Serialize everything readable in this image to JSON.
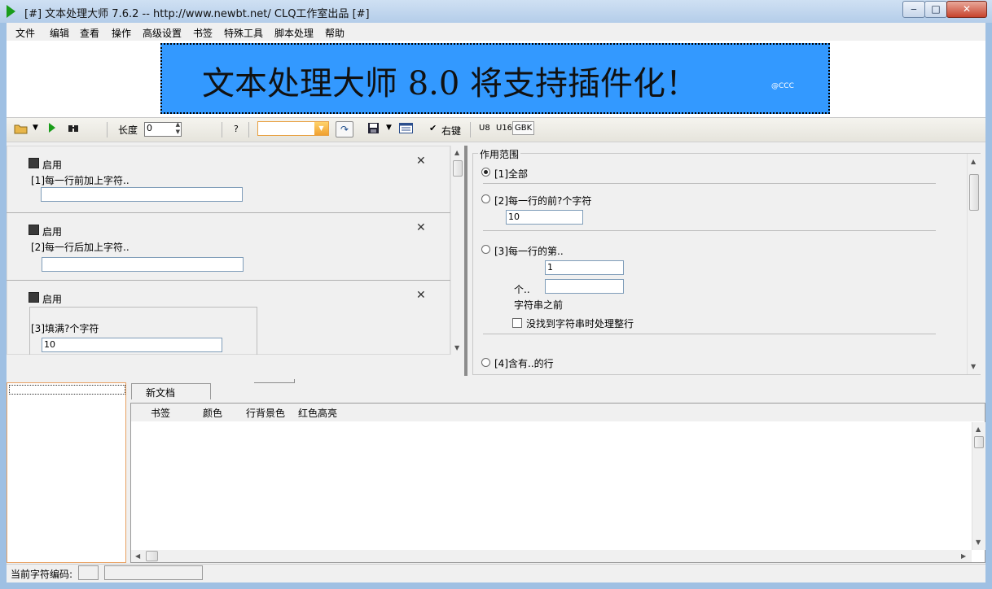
{
  "window": {
    "title": "[#] 文本处理大师 7.6.2 -- http://www.newbt.net/  CLQ工作室出品 [#]",
    "minimize": "‒",
    "maximize": "□",
    "close": "✕"
  },
  "menu": [
    "文件",
    "编辑",
    "查看",
    "操作",
    "高级设置",
    "书签",
    "特殊工具",
    "脚本处理",
    "帮助"
  ],
  "banner": {
    "text": "文本处理大师 8.0 将支持插件化！",
    "tag": "@CCC"
  },
  "toolbar": {
    "length_label": "长度",
    "length_value": "0",
    "help": "?",
    "right_key": "右键",
    "check_mark": "✔",
    "encodings": [
      "U8",
      "U16",
      "GBK"
    ]
  },
  "left_panel": {
    "blocks": [
      {
        "enable": "启用",
        "label": "[1]每一行前加上字符..",
        "value": ""
      },
      {
        "enable": "启用",
        "label": "[2]每一行后加上字符..",
        "value": ""
      },
      {
        "enable": "启用",
        "label": "[3]填满?个字符",
        "value": "10"
      }
    ],
    "close_glyph": "✕"
  },
  "scope": {
    "title": "作用范围",
    "opt1": "[1]全部",
    "opt2": "[2]每一行的前?个字符",
    "opt2_value": "10",
    "opt3": "[3]每一行的第..",
    "opt3_value": "1",
    "opt3_ge": "个..",
    "opt3_ge_value": "",
    "opt3_before": "字符串之前",
    "opt3_checkbox": "没找到字符串时处理整行",
    "opt4": "[4]含有..的行"
  },
  "bottom": {
    "tab_label": "新文档",
    "columns": [
      "书签",
      "颜色",
      "行背景色",
      "红色高亮"
    ]
  },
  "status": {
    "encoding_label": "当前字符编码:",
    "encoding_value": "",
    "message": ""
  },
  "colors": {
    "banner_bg": "#3399ff",
    "title_gradient_top": "#cfe0f3",
    "close_red": "#c7432c"
  }
}
